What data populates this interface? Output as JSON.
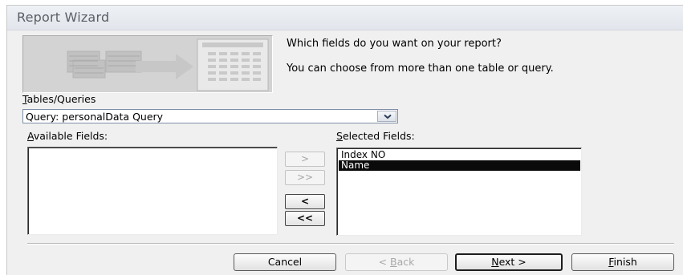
{
  "window": {
    "title": "Report Wizard"
  },
  "header": {
    "question": "Which fields do you want on your report?",
    "hint": "You can choose from more than one table or query."
  },
  "source": {
    "label_hotkey": "T",
    "label_rest": "ables/Queries",
    "selected_value": "Query: personalData Query"
  },
  "available": {
    "label_hotkey": "A",
    "label_rest": "vailable Fields:",
    "items": []
  },
  "selected": {
    "label_hotkey": "S",
    "label_rest": "elected Fields:",
    "items": [
      {
        "label": "Index NO",
        "highlighted": false
      },
      {
        "label": "Name",
        "highlighted": true
      }
    ]
  },
  "move_buttons": {
    "add_one": ">",
    "add_all": ">>",
    "remove_one": "<",
    "remove_all": "<<"
  },
  "footer": {
    "cancel_label": "Cancel",
    "back_prefix": "< ",
    "back_hotkey": "B",
    "back_rest": "ack",
    "next_hotkey": "N",
    "next_rest": "ext >",
    "finish_hotkey": "F",
    "finish_rest": "inish"
  },
  "colors": {
    "dialog_bg": "#f0f0f0",
    "selection_bg": "#0a0a0a",
    "title_text": "#5a5e66"
  },
  "icons": {
    "combo_dropdown": "chevron-down-icon",
    "wizard_graphic": "report-layout-illustration"
  }
}
